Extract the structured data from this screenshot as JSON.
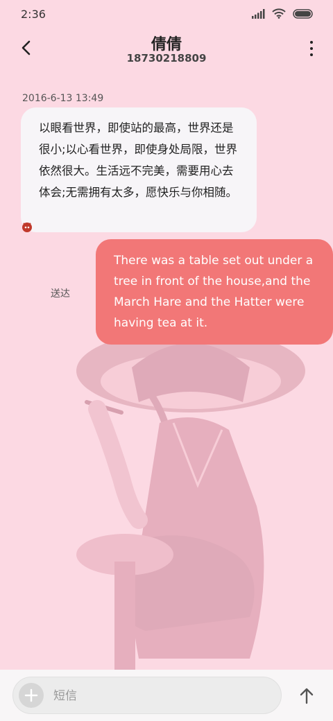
{
  "status": {
    "time": "2:36"
  },
  "header": {
    "title": "倩倩",
    "number": "18730218809"
  },
  "thread": {
    "timestamp": "2016-6-13 13:49",
    "incoming": "以眼看世界，即使站的最高，世界还是很小;以心看世界，即使身处局限，世界依然很大。生活远不完美，需要用心去体会;无需拥有太多，愿快乐与你相随。",
    "outgoing": "There was a table set out under a tree in front of the house,and the March Hare and the Hatter were having tea at it.",
    "outgoing_status": "送达"
  },
  "composer": {
    "placeholder": "短信"
  },
  "colors": {
    "background": "#fcd9e3",
    "outgoing_bubble": "#f27777",
    "incoming_bubble": "#f7f5f8"
  },
  "icons": [
    "signal-icon",
    "wifi-icon",
    "battery-icon",
    "back-icon",
    "more-icon",
    "sim-badge-icon",
    "plus-icon",
    "send-arrow-icon"
  ]
}
